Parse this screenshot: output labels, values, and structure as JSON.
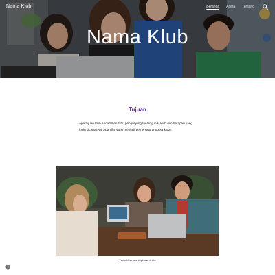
{
  "header": {
    "site_name": "Nama Klub",
    "nav": [
      {
        "label": "Beranda",
        "active": true
      },
      {
        "label": "Acara",
        "active": false
      },
      {
        "label": "Tentang",
        "active": false
      }
    ],
    "search_icon": "search-icon"
  },
  "hero": {
    "title": "Nama Klub"
  },
  "purpose": {
    "heading": "Tujuan",
    "body": "Apa tujuan klub Anda? Beri tahu pengunjung tentang misi klub dan harapan yang ingin dicapainya. Apa nilai yang menjadi pemersatu anggota klub?"
  },
  "photo": {
    "caption": "Tambahkan teks ringkasan di sini"
  },
  "footer": {
    "info_icon": "info-icon"
  },
  "colors": {
    "heading": "#5b2a86",
    "hero_text": "#ffffff",
    "body_text": "#212121"
  }
}
